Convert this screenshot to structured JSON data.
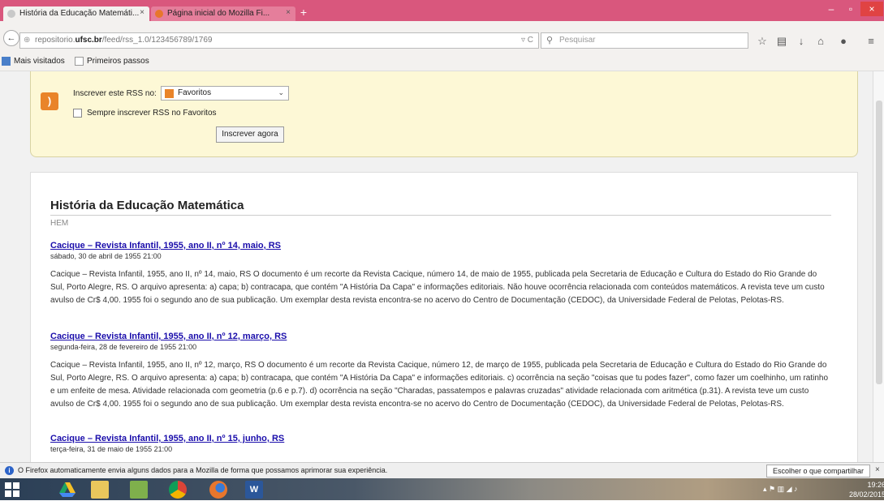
{
  "tabs": [
    {
      "label": "História da Educação Matemáti...",
      "close": "×"
    },
    {
      "label": "Página inicial do Mozilla Fi...",
      "close": "×"
    }
  ],
  "new_tab": "+",
  "window": {
    "min": "–",
    "max": "▫",
    "close": "×"
  },
  "nav": {
    "back": "←",
    "url_prefix": "repositorio.",
    "url_domain": "ufsc.br",
    "url_rest": "/feed/rss_1.0/123456789/1769",
    "reload": "▿ C",
    "search_placeholder": "Pesquisar"
  },
  "toolbar_icons": [
    "star-icon",
    "clipboard-icon",
    "download-icon",
    "home-icon",
    "pocket-icon",
    "menu-icon"
  ],
  "bookmarks": [
    {
      "label": "Mais visitados"
    },
    {
      "label": "Primeiros passos"
    }
  ],
  "rss": {
    "subscribe_label": "Inscrever este RSS no:",
    "selected_reader": "Favoritos",
    "always_label": "Sempre inscrever RSS no Favoritos",
    "button": "Inscrever agora"
  },
  "feed": {
    "title": "História da Educação Matemática",
    "subtitle": "HEM",
    "entries": [
      {
        "title": "Cacique – Revista Infantil, 1955, ano II, nº 14, maio, RS",
        "date": "sábado, 30 de abril de 1955 21:00",
        "body": "Cacique – Revista Infantil, 1955, ano II, nº 14, maio, RS O documento é um recorte da Revista Cacique, número 14, de maio de 1955, publicada pela Secretaria de Educação e Cultura do Estado do Rio Grande do Sul, Porto Alegre, RS. O arquivo apresenta: a) capa; b) contracapa, que contém \"A História Da Capa\" e informações editoriais. Não houve ocorrência relacionada com conteúdos matemáticos. A revista teve um custo avulso de Cr$ 4,00. 1955 foi o segundo ano de sua publicação. Um exemplar desta revista encontra-se no acervo do Centro de Documentação (CEDOC), da Universidade Federal de Pelotas, Pelotas-RS."
      },
      {
        "title": "Cacique – Revista Infantil, 1955, ano II, nº 12, março, RS",
        "date": "segunda-feira, 28 de fevereiro de 1955 21:00",
        "body": "Cacique – Revista Infantil, 1955, ano II, nº 12, março, RS O documento é um recorte da Revista Cacique, número 12, de março de 1955, publicada pela Secretaria de Educação e Cultura do Estado do Rio Grande do Sul, Porto Alegre, RS. O arquivo apresenta: a) capa; b) contracapa, que contém \"A História Da Capa\" e informações editoriais. c) ocorrência na seção \"coisas que tu podes fazer\", como fazer um coelhinho, um ratinho e um enfeite de mesa. Atividade relacionada com geometria (p.6 e p.7). d) ocorrência na seção \"Charadas, passatempos e palavras cruzadas\" atividade relacionada com aritmética (p.31). A revista teve um custo avulso de Cr$ 4,00. 1955 foi o segundo ano de sua publicação. Um exemplar desta revista encontra-se no acervo do Centro de Documentação (CEDOC), da Universidade Federal de Pelotas, Pelotas-RS."
      },
      {
        "title": "Cacique – Revista Infantil, 1955, ano II, nº 15, junho, RS",
        "date": "terça-feira, 31 de maio de 1955 21:00",
        "body": ""
      }
    ]
  },
  "notification": {
    "text": "O Firefox automaticamente envia alguns dados para a Mozilla de forma que possamos aprimorar sua experiência.",
    "button": "Escolher o que compartilhar",
    "close": "×"
  },
  "taskbar": {
    "time": "19:26",
    "date": "28/02/2015"
  },
  "colors": {
    "tabstrip": "#d9577d",
    "link": "#1a0dab",
    "rss_box": "#fdf8d6",
    "rss_orange": "#e9842a"
  }
}
